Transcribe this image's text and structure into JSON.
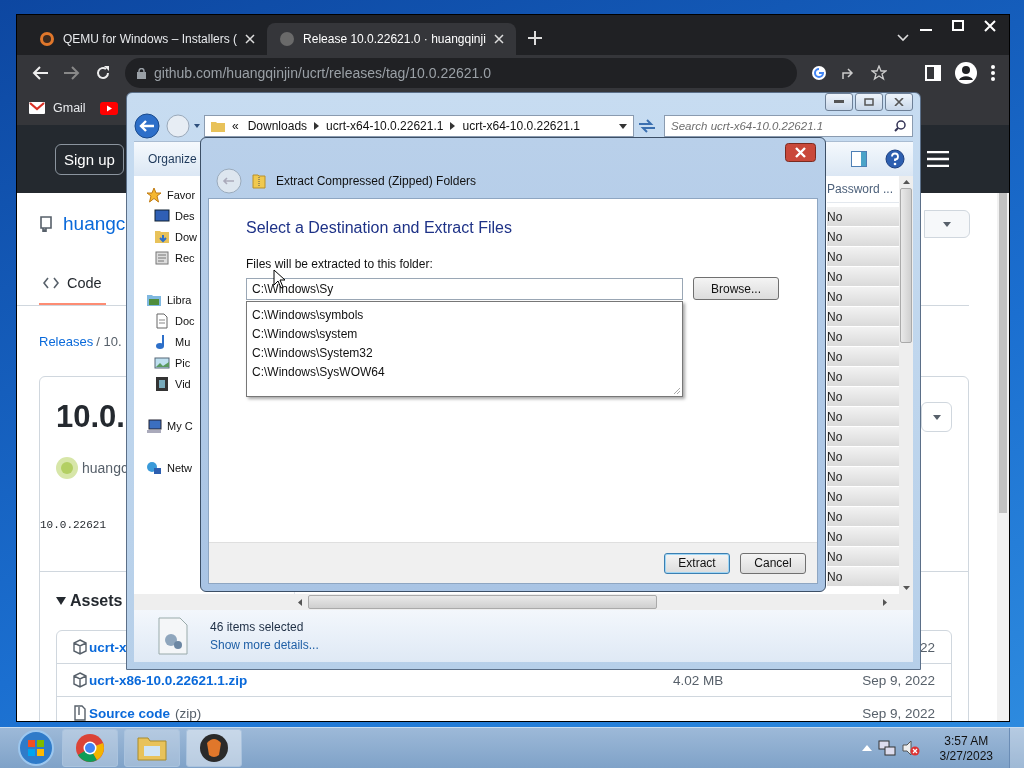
{
  "browser": {
    "tabs": [
      {
        "title": "QEMU for Windows – Installers (",
        "selected": false
      },
      {
        "title": "Release 10.0.22621.0 · huangqinji",
        "selected": true
      }
    ],
    "url": "github.com/huangqinjin/ucrt/releases/tag/10.0.22621.0",
    "bookmarks": [
      "Gmail"
    ]
  },
  "github": {
    "sign_up": "Sign up",
    "repo": "huangc",
    "nav_tab": "Code",
    "breadcrumb_link": "Releases",
    "breadcrumb_rest": "/ 10.",
    "release_title": "10.0.",
    "author": "huangc",
    "tag": "10.0.22621",
    "assets_heading": "Assets",
    "assets": [
      {
        "name": "ucrt-x",
        "date": "22"
      },
      {
        "name": "ucrt-x86-10.0.22621.1.zip",
        "size": "4.02 MB",
        "date": "Sep 9, 2022"
      },
      {
        "name": "Source code",
        "suffix": "(zip)",
        "date": "Sep 9, 2022"
      }
    ]
  },
  "explorer": {
    "breadcrumb_prefix": "«",
    "breadcrumb": [
      "Downloads",
      "ucrt-x64-10.0.22621.1",
      "ucrt-x64-10.0.22621.1"
    ],
    "search_placeholder": "Search ucrt-x64-10.0.22621.1",
    "toolbar": [
      "Organize"
    ],
    "nav": [
      {
        "label": "Favor",
        "children": [
          {
            "label": "Des"
          },
          {
            "label": "Dow"
          },
          {
            "label": "Rec"
          }
        ]
      },
      {
        "label": "Libra",
        "children": [
          {
            "label": "Doc"
          },
          {
            "label": "Mu"
          },
          {
            "label": "Pic"
          },
          {
            "label": "Vid"
          }
        ]
      },
      {
        "label": "My C"
      },
      {
        "label": "Netw"
      }
    ],
    "column": "Password ...",
    "rows": [
      "No",
      "No",
      "No",
      "No",
      "No",
      "No",
      "No",
      "No",
      "No",
      "No",
      "No",
      "No",
      "No",
      "No",
      "No",
      "No",
      "No",
      "No",
      "No"
    ],
    "status": {
      "count": "46 items selected",
      "link": "Show more details..."
    }
  },
  "dialog": {
    "title": "Extract Compressed (Zipped) Folders",
    "heading": "Select a Destination and Extract Files",
    "label": "Files will be extracted to this folder:",
    "value": "C:\\Windows\\Sy",
    "browse": "Browse...",
    "suggestions": [
      "C:\\Windows\\symbols",
      "C:\\Windows\\system",
      "C:\\Windows\\System32",
      "C:\\Windows\\SysWOW64"
    ],
    "buttons": [
      {
        "label": "Extract",
        "default": true
      },
      {
        "label": "Cancel",
        "default": false
      }
    ]
  },
  "taskbar": {
    "time": "3:57 AM",
    "date": "3/27/2023"
  }
}
